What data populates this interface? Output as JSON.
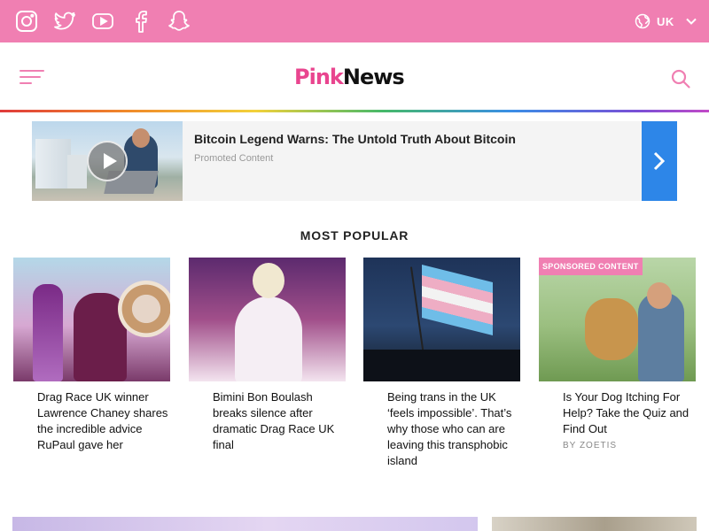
{
  "topbar": {
    "social_icons": [
      "instagram-icon",
      "twitter-icon",
      "youtube-icon",
      "facebook-icon",
      "snapchat-icon"
    ],
    "region_label": "UK"
  },
  "header": {
    "logo_part1": "Pink",
    "logo_part2": "News"
  },
  "promo": {
    "title": "Bitcoin Legend Warns: The Untold Truth About Bitcoin",
    "label": "Promoted Content"
  },
  "most_popular": {
    "title": "MOST POPULAR",
    "items": [
      {
        "headline": "Drag Race UK winner Lawrence Chaney shares the incredible advice RuPaul gave her"
      },
      {
        "headline": "Bimini Bon Boulash breaks silence after dramatic Drag Race UK final"
      },
      {
        "headline": "Being trans in the UK ‘feels impossible’. That’s why those who can are leaving this transphobic island"
      },
      {
        "headline": "Is Your Dog Itching For Help? Take the Quiz and Find Out",
        "badge": "SPONSORED CONTENT",
        "byline": "BY ZOETIS"
      }
    ]
  },
  "colors": {
    "brand_pink": "#f07fb2",
    "logo_pink": "#e9458f",
    "promo_blue": "#2d86e8"
  }
}
